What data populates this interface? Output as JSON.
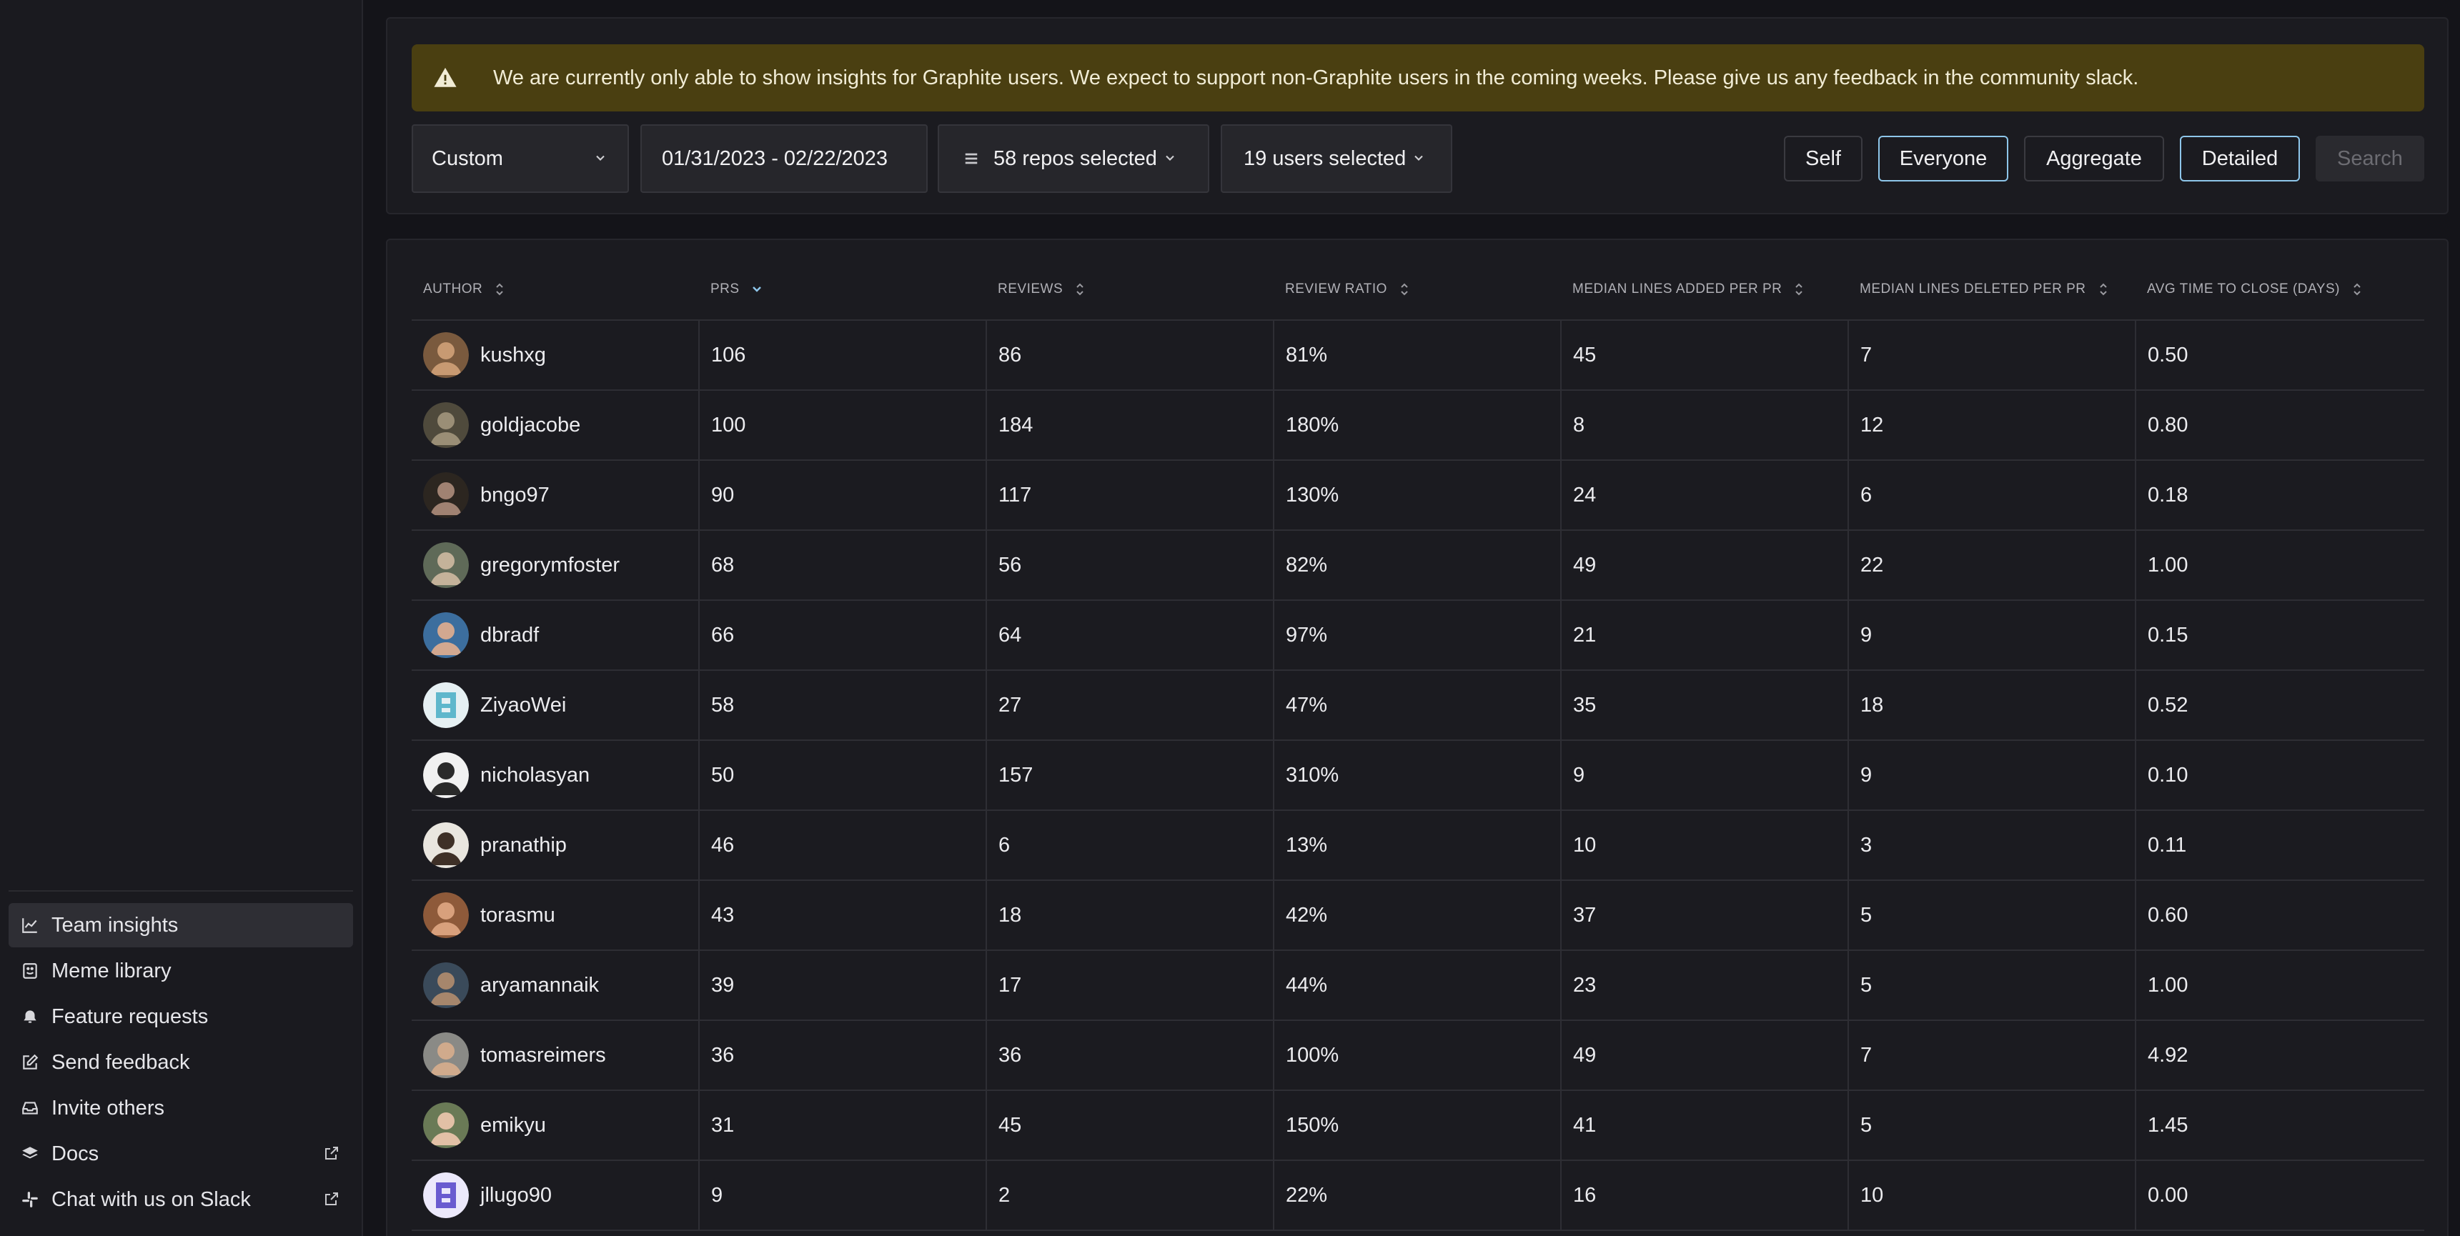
{
  "sidebar": {
    "items": [
      {
        "label": "Team insights",
        "icon": "chart-line-icon",
        "active": true
      },
      {
        "label": "Meme library",
        "icon": "meme-icon"
      },
      {
        "label": "Feature requests",
        "icon": "bell-icon"
      },
      {
        "label": "Send feedback",
        "icon": "edit-icon"
      },
      {
        "label": "Invite others",
        "icon": "inbox-icon"
      },
      {
        "label": "Docs",
        "icon": "layers-icon",
        "external": true
      },
      {
        "label": "Chat with us on Slack",
        "icon": "slack-icon",
        "external": true
      }
    ]
  },
  "banner": {
    "icon": "warning-icon",
    "text": "We are currently only able to show insights for Graphite users. We expect to support non-Graphite users in the coming weeks. Please give us any feedback in the community slack."
  },
  "filters": {
    "range": "Custom",
    "date_range": "01/31/2023 - 02/22/2023",
    "repos": "58 repos selected",
    "users": "19 users selected"
  },
  "buttons": {
    "self": "Self",
    "everyone": "Everyone",
    "aggregate": "Aggregate",
    "detailed": "Detailed",
    "search": "Search"
  },
  "table": {
    "columns": [
      "AUTHOR",
      "PRS",
      "REVIEWS",
      "REVIEW RATIO",
      "MEDIAN LINES ADDED PER PR",
      "MEDIAN LINES DELETED PER PR",
      "AVG TIME TO CLOSE (DAYS)"
    ],
    "sorted_column": "PRS",
    "rows": [
      {
        "author": "kushxg",
        "prs": "106",
        "reviews": "86",
        "ratio": "81%",
        "added": "45",
        "deleted": "7",
        "time": "0.50"
      },
      {
        "author": "goldjacobe",
        "prs": "100",
        "reviews": "184",
        "ratio": "180%",
        "added": "8",
        "deleted": "12",
        "time": "0.80"
      },
      {
        "author": "bngo97",
        "prs": "90",
        "reviews": "117",
        "ratio": "130%",
        "added": "24",
        "deleted": "6",
        "time": "0.18"
      },
      {
        "author": "gregorymfoster",
        "prs": "68",
        "reviews": "56",
        "ratio": "82%",
        "added": "49",
        "deleted": "22",
        "time": "1.00"
      },
      {
        "author": "dbradf",
        "prs": "66",
        "reviews": "64",
        "ratio": "97%",
        "added": "21",
        "deleted": "9",
        "time": "0.15"
      },
      {
        "author": "ZiyaoWei",
        "prs": "58",
        "reviews": "27",
        "ratio": "47%",
        "added": "35",
        "deleted": "18",
        "time": "0.52"
      },
      {
        "author": "nicholasyan",
        "prs": "50",
        "reviews": "157",
        "ratio": "310%",
        "added": "9",
        "deleted": "9",
        "time": "0.10"
      },
      {
        "author": "pranathip",
        "prs": "46",
        "reviews": "6",
        "ratio": "13%",
        "added": "10",
        "deleted": "3",
        "time": "0.11"
      },
      {
        "author": "torasmu",
        "prs": "43",
        "reviews": "18",
        "ratio": "42%",
        "added": "37",
        "deleted": "5",
        "time": "0.60"
      },
      {
        "author": "aryamannaik",
        "prs": "39",
        "reviews": "17",
        "ratio": "44%",
        "added": "23",
        "deleted": "5",
        "time": "1.00"
      },
      {
        "author": "tomasreimers",
        "prs": "36",
        "reviews": "36",
        "ratio": "100%",
        "added": "49",
        "deleted": "7",
        "time": "4.92"
      },
      {
        "author": "emikyu",
        "prs": "31",
        "reviews": "45",
        "ratio": "150%",
        "added": "41",
        "deleted": "5",
        "time": "1.45"
      },
      {
        "author": "jllugo90",
        "prs": "9",
        "reviews": "2",
        "ratio": "22%",
        "added": "16",
        "deleted": "10",
        "time": "0.00"
      }
    ]
  },
  "colors": {
    "background": "#141419",
    "panel": "#1b1b20",
    "banner": "#4a3f11",
    "selected_border": "#8ec6ea",
    "sort_active": "#8ec6ea"
  }
}
